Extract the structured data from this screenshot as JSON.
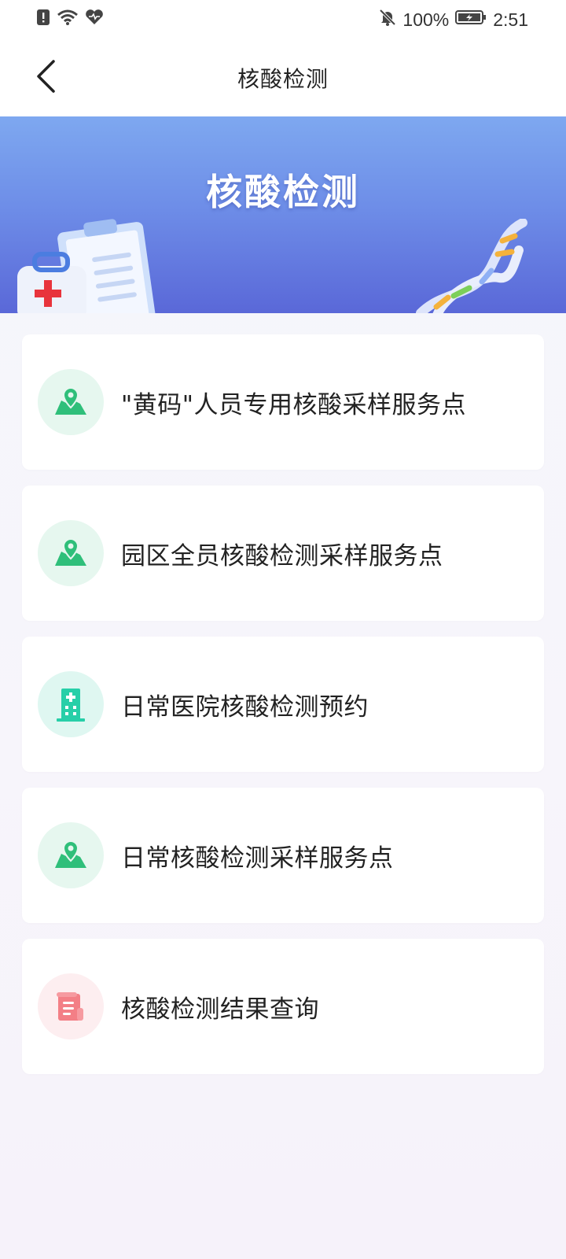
{
  "status_bar": {
    "battery": "100%",
    "time": "2:51",
    "icons": [
      "alert-icon",
      "wifi-icon",
      "heart-icon",
      "mute-bell-icon",
      "battery-icon"
    ]
  },
  "header": {
    "title": "核酸检测",
    "back_icon": "back-chevron-icon"
  },
  "banner": {
    "title": "核酸检测"
  },
  "menu": {
    "items": [
      {
        "label": "\"黄码\"人员专用核酸采样服务点",
        "icon": "map-pin-icon"
      },
      {
        "label": "园区全员核酸检测采样服务点",
        "icon": "map-pin-icon"
      },
      {
        "label": "日常医院核酸检测预约",
        "icon": "hospital-icon"
      },
      {
        "label": "日常核酸检测采样服务点",
        "icon": "map-pin-icon"
      },
      {
        "label": "核酸检测结果查询",
        "icon": "document-scroll-icon"
      }
    ]
  },
  "colors": {
    "banner_top": "#7ea8f0",
    "banner_bottom": "#5a68d8",
    "map_icon": "#2fbf7a",
    "hospital_icon": "#27cfa8",
    "document_icon": "#f37f86"
  }
}
